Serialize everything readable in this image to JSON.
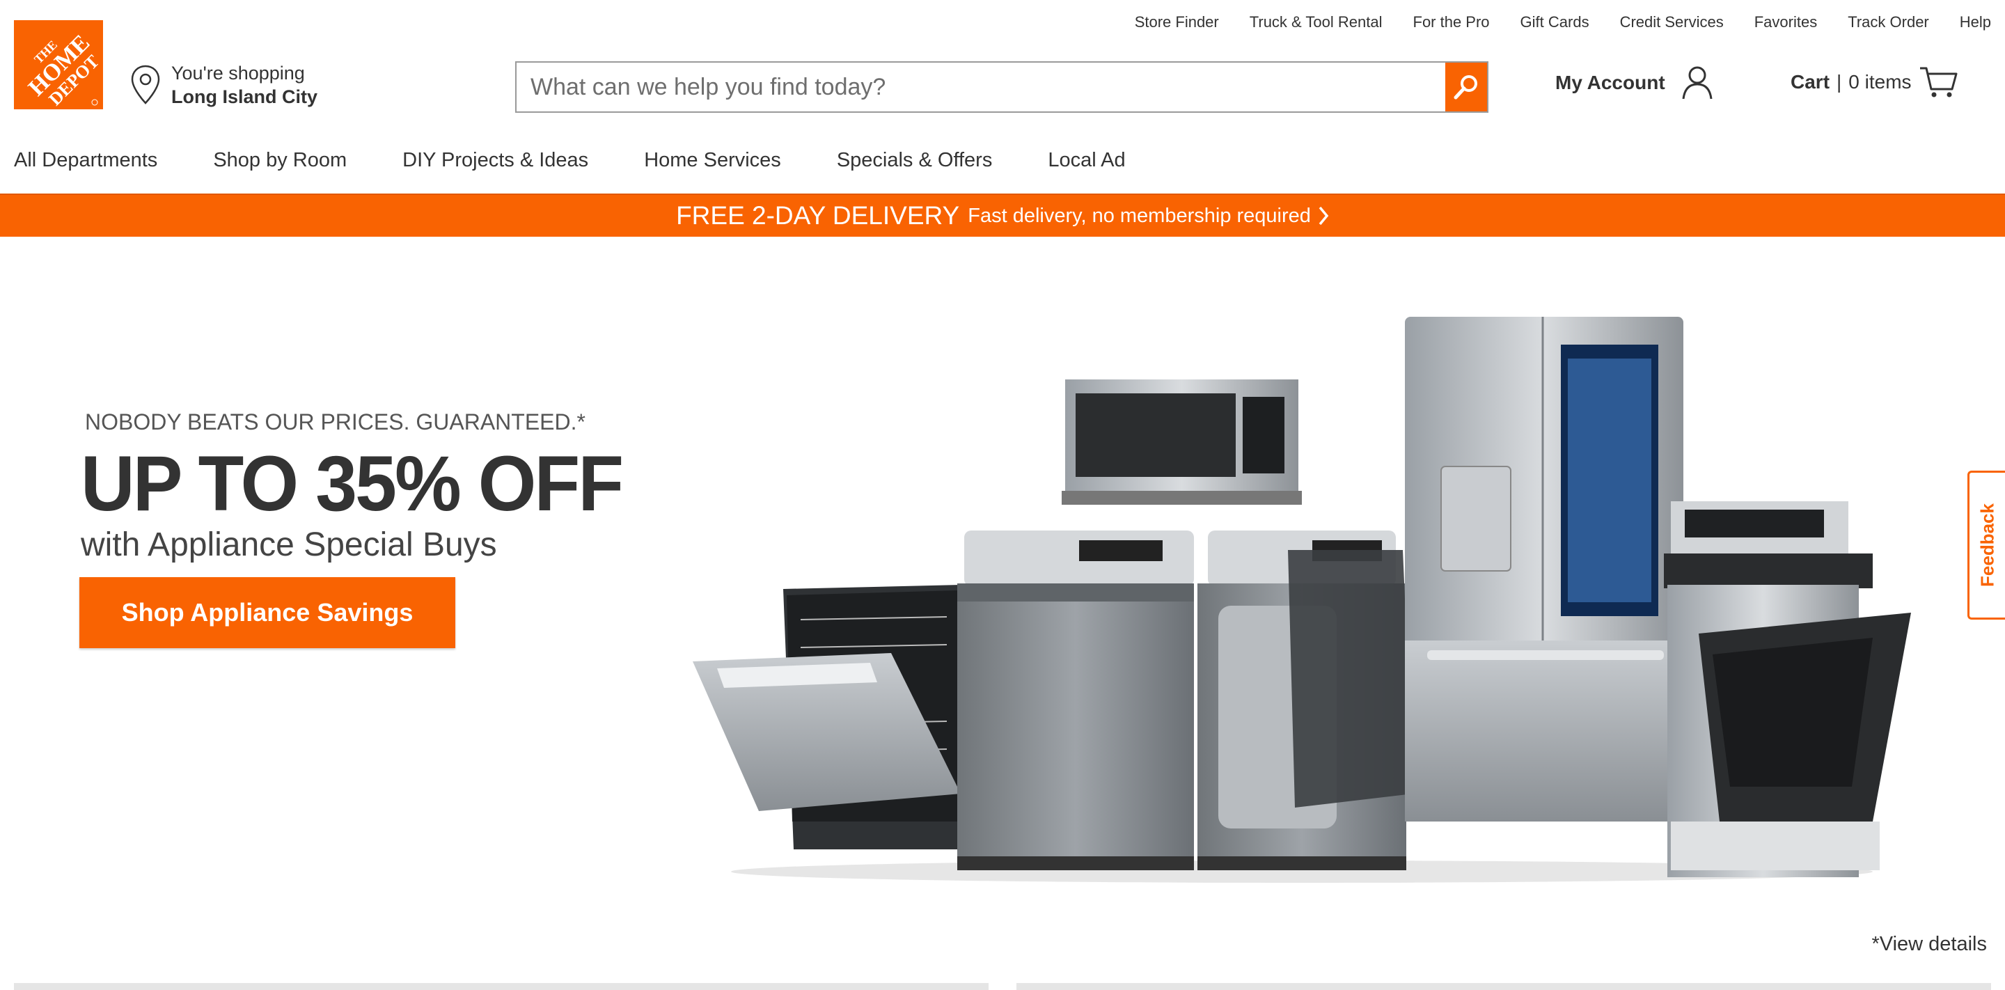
{
  "brand": {
    "logo_alt": "THE HOME DEPOT",
    "accent_color": "#f96302"
  },
  "utility_nav": [
    "Store Finder",
    "Truck & Tool Rental",
    "For the Pro",
    "Gift Cards",
    "Credit Services",
    "Favorites",
    "Track Order",
    "Help"
  ],
  "store": {
    "line1": "You're shopping",
    "line2": "Long Island City",
    "icon": "map-pin-icon"
  },
  "search": {
    "placeholder": "What can we help you find today?",
    "icon": "search-icon"
  },
  "account": {
    "label": "My Account",
    "icon": "user-icon"
  },
  "cart": {
    "label": "Cart",
    "separator": "|",
    "count_text": "0 items",
    "icon": "cart-icon"
  },
  "main_nav": [
    "All Departments",
    "Shop by Room",
    "DIY Projects & Ideas",
    "Home Services",
    "Specials & Offers",
    "Local Ad"
  ],
  "promo": {
    "headline": "FREE 2-DAY DELIVERY",
    "detail": "Fast delivery, no membership required",
    "icon": "chevron-right-icon"
  },
  "hero": {
    "guarantee": "NOBODY BEATS OUR PRICES. GUARANTEED.*",
    "headline": "UP TO 35% OFF",
    "subhead": "with Appliance Special Buys",
    "cta": "Shop Appliance Savings",
    "view_details": "*View details"
  },
  "feedback": {
    "label": "Feedback",
    "icon": "feedback-icon"
  }
}
